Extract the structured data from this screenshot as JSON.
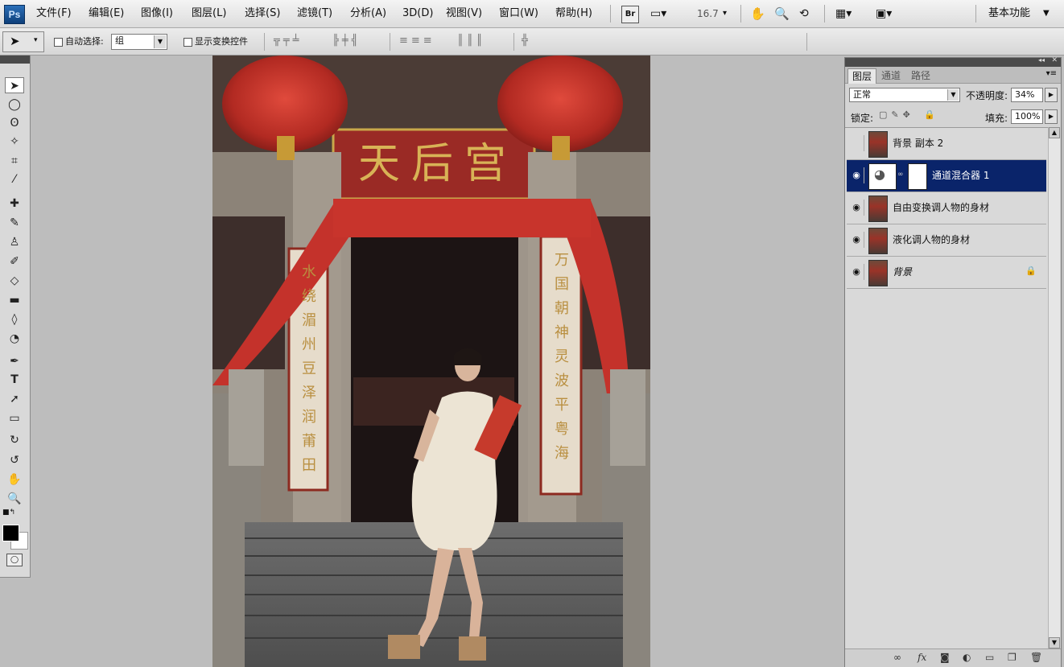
{
  "app": {
    "logo": "Ps"
  },
  "menu": {
    "items": [
      "文件(F)",
      "编辑(E)",
      "图像(I)",
      "图层(L)",
      "选择(S)",
      "滤镜(T)",
      "分析(A)",
      "3D(D)",
      "视图(V)",
      "窗口(W)",
      "帮助(H)"
    ],
    "bridge": "Br",
    "zoom": "16.7",
    "workspace": "基本功能"
  },
  "options": {
    "auto_select_label": "自动选择:",
    "auto_select_value": "组",
    "show_transform_label": "显示变换控件"
  },
  "icons": {
    "move": "move-tool-icon",
    "hand": "hand-icon",
    "zoom": "zoom-icon",
    "rotate": "rotate-view-icon",
    "eye": "eye-icon",
    "lock": "lock-icon",
    "link": "link-icon",
    "fx": "fx-icon",
    "mask": "add-mask-icon",
    "adjust": "adjustment-icon",
    "folder": "new-group-icon",
    "new_layer": "new-layer-icon",
    "trash": "trash-icon"
  },
  "layers_panel": {
    "tabs": [
      "图层",
      "通道",
      "路径"
    ],
    "blend_mode": "正常",
    "opacity_label": "不透明度:",
    "opacity_value": "34%",
    "lock_label": "锁定:",
    "fill_label": "填充:",
    "fill_value": "100%",
    "layers": [
      {
        "name": "背景 副本 2",
        "visible": false,
        "selected": false
      },
      {
        "name": "通道混合器 1",
        "visible": true,
        "selected": true
      },
      {
        "name": "自由变换调人物的身材",
        "visible": true,
        "selected": false
      },
      {
        "name": "液化调人物的身材",
        "visible": true,
        "selected": false
      },
      {
        "name": "背景",
        "visible": true,
        "selected": false,
        "locked": true
      }
    ],
    "bottom_fx": "fx"
  },
  "canvas": {
    "plaque_text": "天后宫",
    "left_couplet": "水绕湄州豆泽润莆田",
    "right_couplet": "万国朝神灵波平粤海"
  },
  "colors": {
    "selection": "#0a246a",
    "lantern": "#c8312a",
    "ps_blue": "#1d5aa0"
  }
}
